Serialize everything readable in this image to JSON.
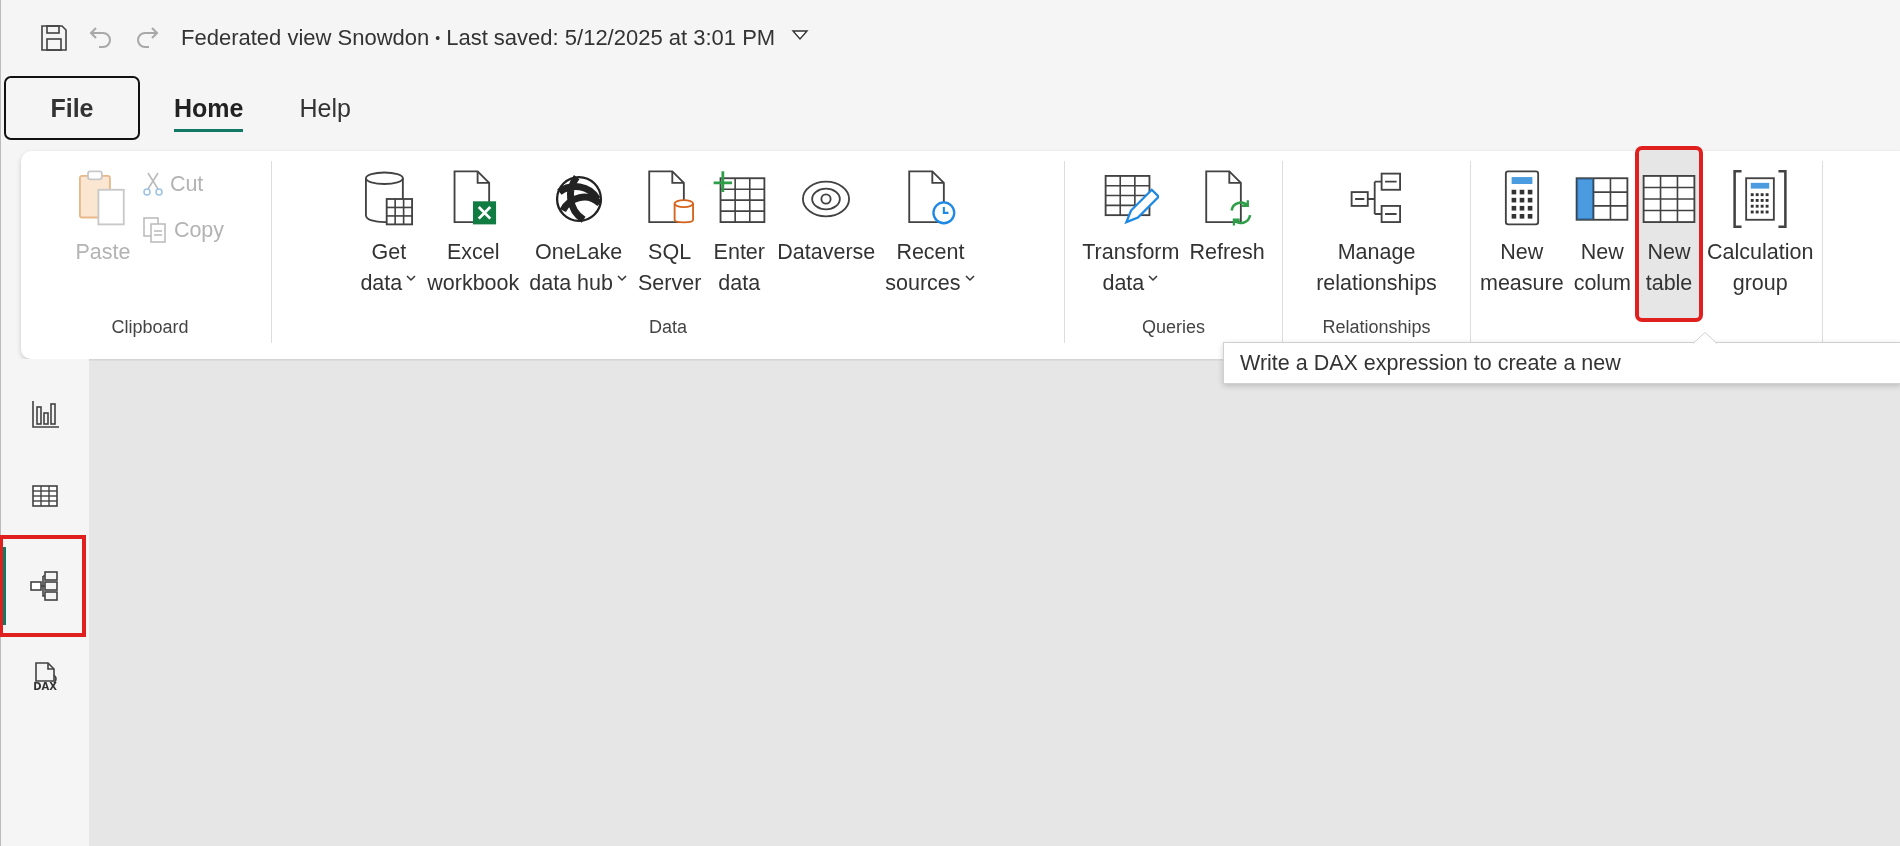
{
  "title_bar": {
    "file_name": "Federated view Snowdon",
    "separator": "•",
    "saved": "Last saved: 5/12/2025 at 3:01 PM",
    "undo_disabled": true,
    "redo_disabled": true
  },
  "tabs": [
    {
      "label": "File",
      "selected": false,
      "focused": true
    },
    {
      "label": "Home",
      "selected": true,
      "focused": false
    },
    {
      "label": "Help",
      "selected": false,
      "focused": false
    }
  ],
  "ribbon": {
    "groups": [
      {
        "label": "Clipboard",
        "buttons": [
          {
            "kind": "large",
            "lines": [
              "Paste"
            ],
            "dropdown": false,
            "disabled": true,
            "highlighted": false,
            "annotated": false
          },
          {
            "kind": "small",
            "lines": [
              "Cut"
            ],
            "dropdown": false,
            "disabled": true,
            "highlighted": false,
            "annotated": false
          },
          {
            "kind": "small",
            "lines": [
              "Copy"
            ],
            "dropdown": false,
            "disabled": true,
            "highlighted": false,
            "annotated": false
          }
        ]
      },
      {
        "label": "Data",
        "buttons": [
          {
            "kind": "large",
            "lines": [
              "Get",
              "data"
            ],
            "dropdown": true,
            "disabled": false,
            "highlighted": false,
            "annotated": false
          },
          {
            "kind": "large",
            "lines": [
              "Excel",
              "workbook"
            ],
            "dropdown": false,
            "disabled": false,
            "highlighted": false,
            "annotated": false
          },
          {
            "kind": "large",
            "lines": [
              "OneLake",
              "data hub"
            ],
            "dropdown": true,
            "disabled": false,
            "highlighted": false,
            "annotated": false
          },
          {
            "kind": "large",
            "lines": [
              "SQL",
              "Server"
            ],
            "dropdown": false,
            "disabled": false,
            "highlighted": false,
            "annotated": false
          },
          {
            "kind": "large",
            "lines": [
              "Enter",
              "data"
            ],
            "dropdown": false,
            "disabled": false,
            "highlighted": false,
            "annotated": false
          },
          {
            "kind": "large",
            "lines": [
              "Dataverse"
            ],
            "dropdown": false,
            "disabled": false,
            "highlighted": false,
            "annotated": false
          },
          {
            "kind": "large",
            "lines": [
              "Recent",
              "sources"
            ],
            "dropdown": true,
            "disabled": false,
            "highlighted": false,
            "annotated": false
          }
        ]
      },
      {
        "label": "Queries",
        "buttons": [
          {
            "kind": "large",
            "lines": [
              "Transform",
              "data"
            ],
            "dropdown": true,
            "disabled": false,
            "highlighted": false,
            "annotated": false
          },
          {
            "kind": "large",
            "lines": [
              "Refresh"
            ],
            "dropdown": false,
            "disabled": false,
            "highlighted": false,
            "annotated": false
          }
        ]
      },
      {
        "label": "Relationships",
        "buttons": [
          {
            "kind": "large",
            "lines": [
              "Manage",
              "relationships"
            ],
            "dropdown": false,
            "disabled": false,
            "highlighted": false,
            "annotated": false
          }
        ]
      },
      {
        "buttons": [
          {
            "kind": "large",
            "lines": [
              "New",
              "measure"
            ],
            "dropdown": false,
            "disabled": false,
            "highlighted": false,
            "annotated": false
          },
          {
            "kind": "large",
            "lines": [
              "New",
              "colum"
            ],
            "dropdown": false,
            "disabled": false,
            "highlighted": false,
            "annotated": false
          },
          {
            "kind": "large",
            "lines": [
              "New",
              "table"
            ],
            "dropdown": false,
            "disabled": false,
            "highlighted": true,
            "annotated": true
          },
          {
            "kind": "large",
            "lines": [
              "Calculation",
              "group"
            ],
            "dropdown": false,
            "disabled": false,
            "highlighted": false,
            "annotated": false
          }
        ]
      }
    ]
  },
  "tooltip": {
    "text": "Write a DAX expression to create a new"
  },
  "view_rail": [
    {
      "selected": false,
      "annotated": false
    },
    {
      "selected": false,
      "annotated": false
    },
    {
      "selected": true,
      "annotated": true
    },
    {
      "selected": false,
      "annotated": false,
      "badge": "DAX"
    }
  ]
}
